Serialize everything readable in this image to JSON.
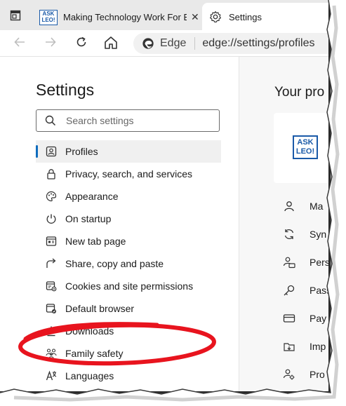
{
  "browser": {
    "tabs": [
      {
        "label": "Making Technology Work For Everyone",
        "favicon_text": "ASK LEO!",
        "close": "✕"
      },
      {
        "label": "Settings"
      }
    ],
    "address": {
      "brand": "Edge",
      "url": "edge://settings/profiles"
    }
  },
  "sidebar": {
    "title": "Settings",
    "search_placeholder": "Search settings",
    "items": [
      {
        "label": "Profiles",
        "icon": "profile-card-icon",
        "active": true
      },
      {
        "label": "Privacy, search, and services",
        "icon": "lock-icon"
      },
      {
        "label": "Appearance",
        "icon": "palette-icon"
      },
      {
        "label": "On startup",
        "icon": "power-icon"
      },
      {
        "label": "New tab page",
        "icon": "new-tab-icon"
      },
      {
        "label": "Share, copy and paste",
        "icon": "share-icon"
      },
      {
        "label": "Cookies and site permissions",
        "icon": "cookies-permissions-icon"
      },
      {
        "label": "Default browser",
        "icon": "default-browser-icon"
      },
      {
        "label": "Downloads",
        "icon": "download-icon"
      },
      {
        "label": "Family safety",
        "icon": "family-icon"
      },
      {
        "label": "Languages",
        "icon": "languages-icon"
      }
    ]
  },
  "main": {
    "heading": "Your pro",
    "profile_logo_text": "ASK LEO!",
    "items": [
      {
        "label": "Ma",
        "icon": "person-icon"
      },
      {
        "label": "Syn",
        "icon": "sync-icon"
      },
      {
        "label": "Pers",
        "icon": "personal-info-icon"
      },
      {
        "label": "Pass",
        "icon": "key-icon"
      },
      {
        "label": "Pay",
        "icon": "card-icon"
      },
      {
        "label": "Imp",
        "icon": "import-icon"
      },
      {
        "label": "Pro",
        "icon": "profile-settings-icon"
      }
    ]
  },
  "colors": {
    "accent": "#0f6cbd",
    "highlight_ellipse": "#e8141e",
    "brand_blue": "#1a5aa8"
  }
}
